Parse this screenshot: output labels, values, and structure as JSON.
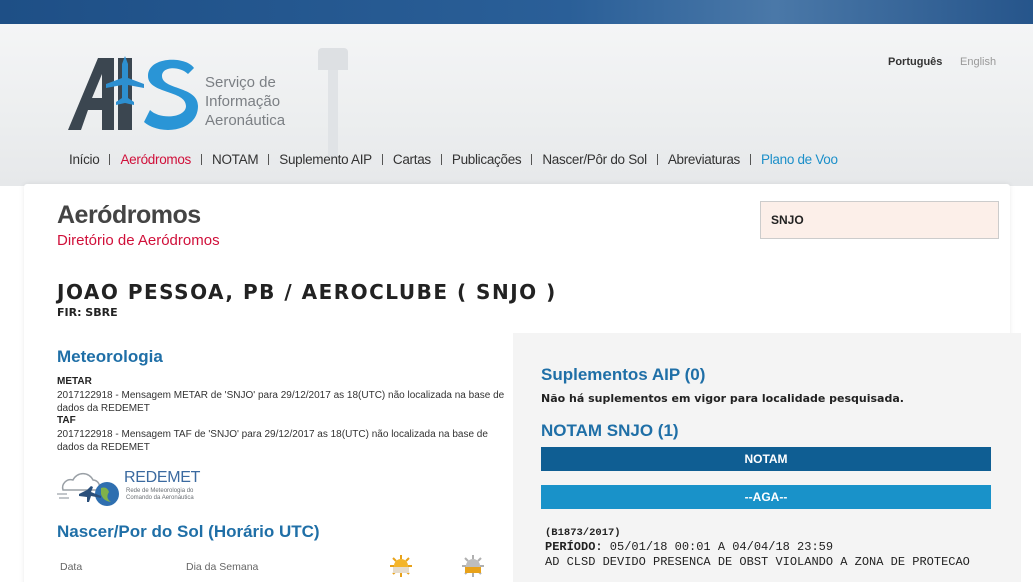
{
  "header": {
    "logo_text_lines": [
      "Serviço de",
      "Informação",
      "Aeronáutica"
    ],
    "languages": [
      "Português",
      "English"
    ],
    "nav": [
      "Início",
      "Aeródromos",
      "NOTAM",
      "Suplemento AIP",
      "Cartas",
      "Publicações",
      "Nascer/Pôr do Sol",
      "Abreviaturas",
      "Plano de Voo"
    ],
    "active_nav": "Aeródromos"
  },
  "page": {
    "title": "Aeródromos",
    "subtitle": "Diretório de Aeródromos",
    "search_value": "SNJO"
  },
  "airport": {
    "name": "JOAO PESSOA, PB / AEROCLUBE ( SNJO )",
    "fir": "FIR: SBRE"
  },
  "meteorologia": {
    "heading": "Meteorologia",
    "metar_label": "METAR",
    "metar_text": "2017122918 - Mensagem METAR de 'SNJO' para 29/12/2017 as 18(UTC) não localizada na base de dados da REDEMET",
    "taf_label": "TAF",
    "taf_text": "2017122918 - Mensagem TAF de 'SNJO' para 29/12/2017 as 18(UTC) não localizada na base de dados da REDEMET",
    "redemet_title": "REDEMET",
    "redemet_sub": "Rede de Meteorologia do Comando da Aeronáutica"
  },
  "sun": {
    "heading": "Nascer/Por do Sol (Horário UTC)",
    "col_data": "Data",
    "col_dia": "Dia da Semana"
  },
  "suplementos": {
    "heading": "Suplementos AIP (0)",
    "text": "Não há suplementos em vigor para localidade pesquisada."
  },
  "notam": {
    "heading": "NOTAM SNJO (1)",
    "bar_label": "NOTAM",
    "section_label": "--AGA--",
    "id": "(B1873/2017)",
    "period_label": "PERÍODO:",
    "period_value": " 05/01/18 00:01 A 04/04/18 23:59",
    "text": "AD CLSD DEVIDO PRESENCA DE OBST VIOLANDO A ZONA DE PROTECAO"
  },
  "colors": {
    "accent_red": "#d0103a",
    "heading_blue": "#1f6fa7",
    "notam_bar": "#0f5e93",
    "aga_bar": "#1992c9"
  }
}
